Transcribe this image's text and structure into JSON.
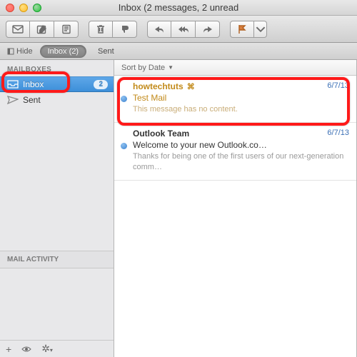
{
  "window": {
    "title": "Inbox (2 messages, 2 unread"
  },
  "subbar": {
    "hide": "Hide",
    "tabs": [
      {
        "label": "Inbox (2)",
        "active": true
      },
      {
        "label": "Sent",
        "active": false
      }
    ]
  },
  "sidebar": {
    "section": "MAILBOXES",
    "items": [
      {
        "label": "Inbox",
        "count": "2",
        "selected": true
      },
      {
        "label": "Sent",
        "selected": false
      }
    ],
    "activity": "MAIL ACTIVITY"
  },
  "list": {
    "sort": "Sort by Date",
    "messages": [
      {
        "from": "howtechtuts",
        "date": "6/7/13",
        "subject": "Test Mail",
        "preview": "This message has no content.",
        "selected": true,
        "vip": true
      },
      {
        "from": "Outlook Team",
        "date": "6/7/13",
        "subject": "Welcome to your new Outlook.co…",
        "preview": "Thanks for being one of the first users of our next-generation comm…",
        "selected": false,
        "vip": false
      }
    ]
  }
}
